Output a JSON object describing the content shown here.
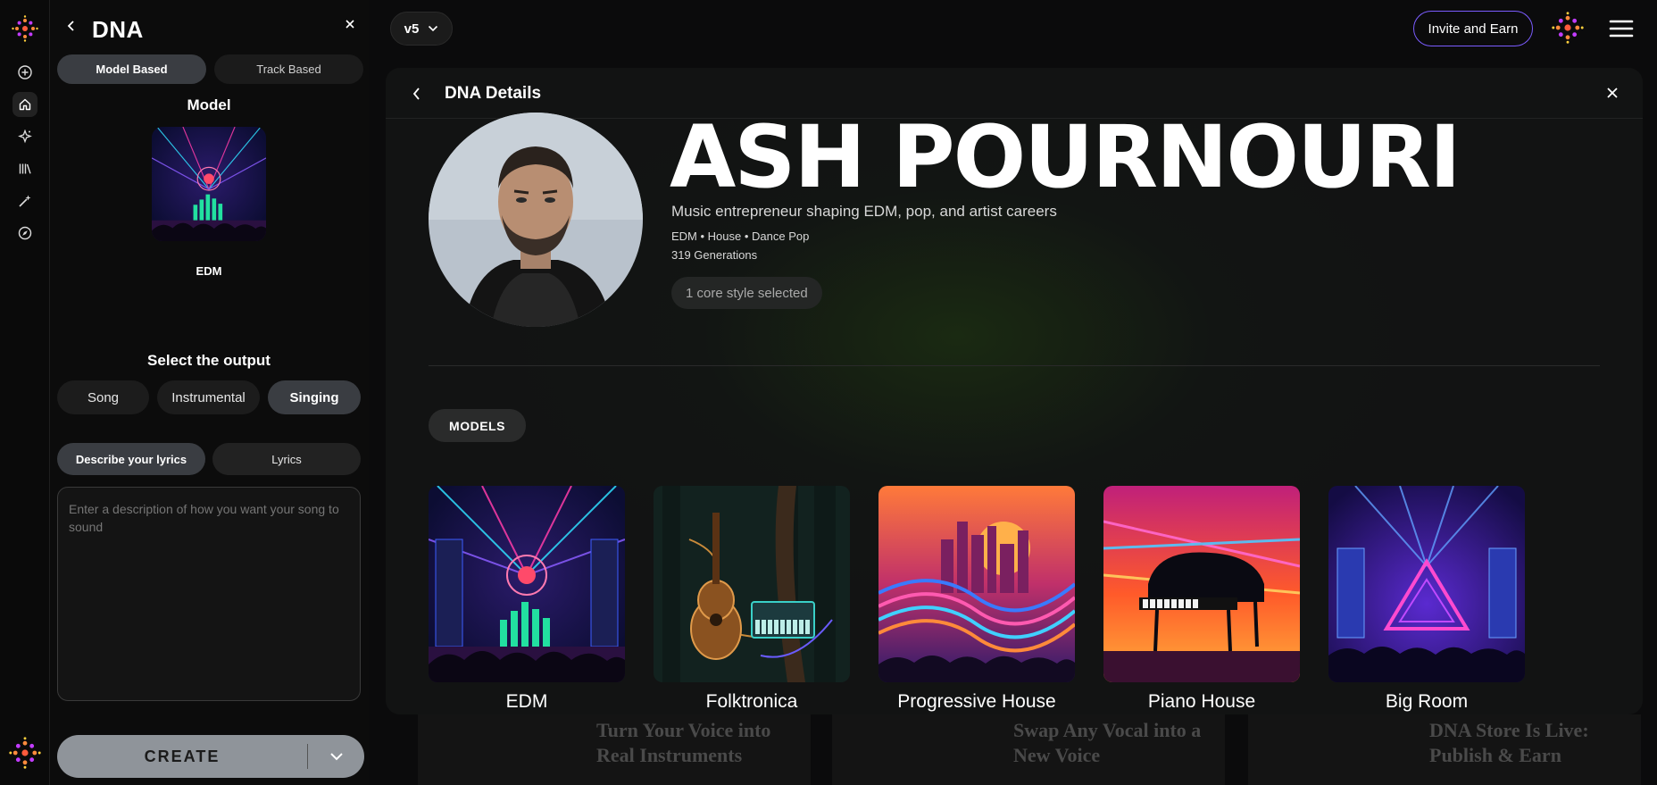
{
  "sidebar_rail": {
    "items": [
      {
        "name": "add-icon"
      },
      {
        "name": "home-icon"
      },
      {
        "name": "sparkle-icon"
      },
      {
        "name": "library-icon"
      },
      {
        "name": "magic-icon"
      },
      {
        "name": "explore-icon"
      }
    ]
  },
  "panel": {
    "title": "DNA",
    "mode_tabs": [
      "Model Based",
      "Track Based"
    ],
    "model_label": "Model",
    "model_name": "EDM",
    "output_label": "Select the output",
    "output_options": [
      "Song",
      "Instrumental",
      "Singing"
    ],
    "lyrics_tabs": [
      "Describe your lyrics",
      "Lyrics"
    ],
    "description_placeholder": "Enter a description of how you want your song to sound",
    "create_label": "CREATE"
  },
  "topbar": {
    "version": "v5",
    "invite_label": "Invite and Earn"
  },
  "promos": [
    {
      "text": "Turn Your Voice into Real Instruments"
    },
    {
      "text": "Swap Any Vocal into a New Voice"
    },
    {
      "text": "DNA Store Is Live: Publish & Earn"
    }
  ],
  "modal": {
    "title": "DNA Details",
    "artist_name": "ASH POURNOURI",
    "bio": "Music entrepreneur shaping EDM, pop, and artist careers",
    "genres": "EDM • House • Dance Pop",
    "generations": "319 Generations",
    "core_style": "1 core style selected",
    "models_tab": "MODELS",
    "models": [
      {
        "name": "EDM"
      },
      {
        "name": "Folktronica"
      },
      {
        "name": "Progressive House"
      },
      {
        "name": "Piano House"
      },
      {
        "name": "Big Room"
      }
    ]
  },
  "colors": {
    "accent": "#7b5cff",
    "create_button": "#8f949a",
    "panel_bg": "#0c0c0c",
    "modal_bg": "#121313"
  }
}
